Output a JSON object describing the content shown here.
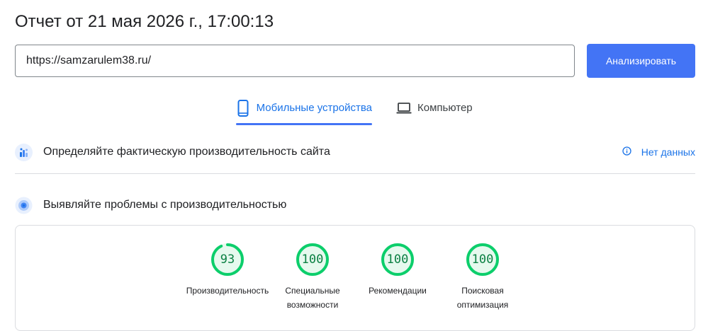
{
  "report": {
    "title": "Отчет от 21 мая 2026 г., 17:00:13"
  },
  "url_input": {
    "value": "https://samzarulem38.ru/"
  },
  "analyze_button": {
    "label": "Анализировать",
    "color": "#4374f5"
  },
  "tabs": [
    {
      "label": "Мобильные устройства",
      "icon": "smartphone-icon",
      "active": true
    },
    {
      "label": "Компьютер",
      "icon": "laptop-icon",
      "active": false
    }
  ],
  "field_data": {
    "title": "Определяйте фактическую производительность сайта",
    "icon": "crux-people-icon",
    "status": "Нет данных",
    "status_icon": "info-icon"
  },
  "lab_data": {
    "title": "Выявляйте проблемы с производительностью",
    "icon": "lighthouse-target-icon"
  },
  "scores": [
    {
      "value": "93",
      "label": "Производительность",
      "color": "#0cce6b"
    },
    {
      "value": "100",
      "label": "Специальные возможности",
      "color": "#0cce6b"
    },
    {
      "value": "100",
      "label": "Рекомендации",
      "color": "#0cce6b"
    },
    {
      "value": "100",
      "label": "Поисковая оптимизация",
      "color": "#0cce6b"
    }
  ]
}
